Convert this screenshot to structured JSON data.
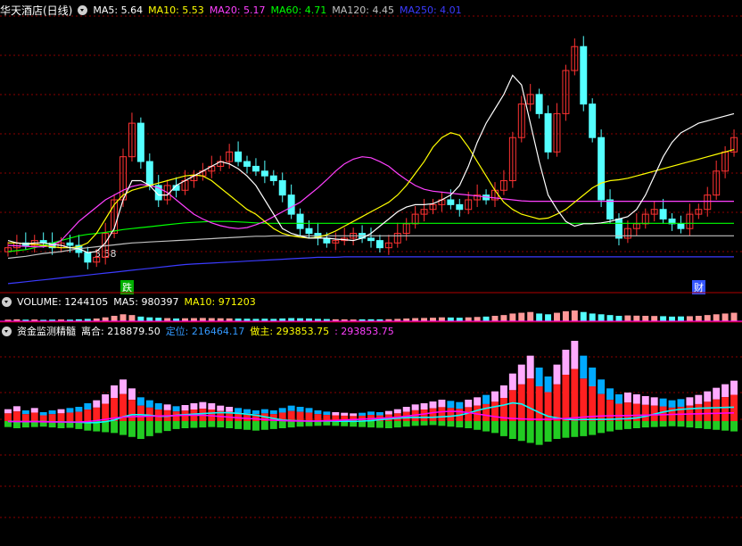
{
  "colors": {
    "bg": "#000000",
    "grid": "#8b0000",
    "separator": "#b00000",
    "up": "#ff3333",
    "down": "#54ffff",
    "ma5": "#ffffff",
    "ma10": "#ffff00",
    "ma20": "#ff40ff",
    "ma60": "#00ff00",
    "ma120": "#c0c0c0",
    "ma250": "#3b3bff",
    "fund_pink": "#ffaaff",
    "fund_red": "#ff2020",
    "fund_blue": "#00aaff",
    "fund_green": "#22cc22",
    "fund_cyan": "#00ffff",
    "fund_magenta": "#ff00ff"
  },
  "price_panel": {
    "title": "华天酒店(日线)",
    "ma_labels": [
      {
        "text": "MA5: 5.64",
        "color": "#ffffff"
      },
      {
        "text": "MA10: 5.53",
        "color": "#ffff00"
      },
      {
        "text": "MA20: 5.17",
        "color": "#ff40ff"
      },
      {
        "text": "MA60: 4.71",
        "color": "#00ff00"
      },
      {
        "text": "MA120: 4.45",
        "color": "#c0c0c0"
      },
      {
        "text": "MA250: 4.01",
        "color": "#3b3bff"
      }
    ],
    "low_marker": "3.58",
    "signal_fall": "跌",
    "signal_fin": "财"
  },
  "volume_panel": {
    "labels": [
      {
        "text": "VOLUME: 1244105",
        "color": "#ffffff"
      },
      {
        "text": "MA5: 980397",
        "color": "#ffffff"
      },
      {
        "text": "MA10: 971203",
        "color": "#ffff00"
      }
    ]
  },
  "fund_panel": {
    "labels": [
      {
        "text": "资金监测精髓",
        "color": "#ffffff"
      },
      {
        "text": "离合: 218879.50",
        "color": "#ffffff"
      },
      {
        "text": "定位: 216464.17",
        "color": "#3399ff"
      },
      {
        "text": "做主: 293853.75",
        "color": "#ffff00"
      },
      {
        "text": ": 293853.75",
        "color": "#ff40ff"
      }
    ]
  },
  "chart_data": [
    {
      "type": "candlestick",
      "title": "华天酒店(日线)",
      "low_label": 3.58,
      "ma_latest": {
        "MA5": 5.64,
        "MA10": 5.53,
        "MA20": 5.17,
        "MA60": 4.71,
        "MA120": 4.45,
        "MA250": 4.01
      },
      "ylim": [
        3.3,
        9.0
      ],
      "close": [
        4.2,
        4.3,
        4.25,
        4.35,
        4.3,
        4.2,
        4.3,
        4.25,
        4.1,
        3.9,
        4.0,
        4.5,
        5.2,
        6.1,
        6.8,
        6.0,
        5.5,
        5.2,
        5.5,
        5.4,
        5.6,
        5.7,
        5.8,
        5.9,
        6.0,
        6.2,
        6.0,
        5.9,
        5.8,
        5.7,
        5.6,
        5.3,
        4.9,
        4.6,
        4.5,
        4.4,
        4.3,
        4.35,
        4.4,
        4.5,
        4.4,
        4.35,
        4.2,
        4.3,
        4.5,
        4.7,
        4.9,
        5.0,
        5.1,
        5.2,
        5.1,
        5.0,
        5.2,
        5.3,
        5.2,
        5.4,
        5.6,
        6.5,
        7.2,
        7.4,
        7.0,
        6.2,
        7.0,
        7.9,
        8.4,
        7.2,
        6.5,
        5.2,
        4.8,
        4.4,
        4.6,
        4.7,
        4.9,
        5.0,
        4.8,
        4.7,
        4.6,
        4.9,
        5.0,
        5.3,
        5.8,
        6.2,
        6.5
      ],
      "ma5": [
        4.35,
        4.3,
        4.28,
        4.3,
        4.3,
        4.27,
        4.25,
        4.2,
        4.18,
        4.1,
        4.12,
        4.3,
        4.6,
        5.2,
        5.6,
        5.6,
        5.5,
        5.3,
        5.3,
        5.5,
        5.6,
        5.7,
        5.8,
        5.9,
        6.0,
        5.95,
        5.85,
        5.7,
        5.5,
        5.2,
        4.9,
        4.6,
        4.5,
        4.45,
        4.4,
        4.4,
        4.4,
        4.38,
        4.37,
        4.35,
        4.4,
        4.5,
        4.65,
        4.8,
        4.95,
        5.05,
        5.1,
        5.1,
        5.12,
        5.2,
        5.3,
        5.5,
        5.9,
        6.4,
        6.8,
        7.1,
        7.4,
        7.8,
        7.6,
        6.8,
        6.0,
        5.3,
        5.0,
        4.75,
        4.65,
        4.7,
        4.7,
        4.72,
        4.75,
        4.8,
        4.85,
        5.0,
        5.3,
        5.7,
        6.1,
        6.4,
        6.6,
        6.7,
        6.8,
        6.85,
        6.9,
        6.95,
        7.0
      ],
      "ma10": [
        4.3,
        4.3,
        4.28,
        4.27,
        4.25,
        4.22,
        4.2,
        4.2,
        4.22,
        4.3,
        4.5,
        4.8,
        5.1,
        5.3,
        5.4,
        5.45,
        5.5,
        5.55,
        5.6,
        5.65,
        5.7,
        5.72,
        5.7,
        5.6,
        5.45,
        5.3,
        5.15,
        5.0,
        4.9,
        4.75,
        4.6,
        4.5,
        4.45,
        4.42,
        4.4,
        4.42,
        4.47,
        4.55,
        4.65,
        4.75,
        4.85,
        4.95,
        5.05,
        5.15,
        5.3,
        5.5,
        5.75,
        6.0,
        6.3,
        6.5,
        6.6,
        6.55,
        6.3,
        6.0,
        5.7,
        5.4,
        5.15,
        5.0,
        4.9,
        4.85,
        4.8,
        4.82,
        4.9,
        5.0,
        5.15,
        5.3,
        5.45,
        5.55,
        5.6,
        5.62,
        5.65,
        5.7,
        5.75,
        5.8,
        5.85,
        5.9,
        5.95,
        6.0,
        6.05,
        6.1,
        6.15,
        6.2,
        6.25
      ],
      "ma20": [
        4.25,
        4.24,
        4.23,
        4.22,
        4.22,
        4.25,
        4.35,
        4.55,
        4.75,
        4.9,
        5.05,
        5.2,
        5.3,
        5.4,
        5.48,
        5.52,
        5.5,
        5.45,
        5.35,
        5.2,
        5.05,
        4.9,
        4.8,
        4.72,
        4.66,
        4.62,
        4.6,
        4.62,
        4.68,
        4.75,
        4.85,
        4.95,
        5.05,
        5.15,
        5.3,
        5.45,
        5.62,
        5.8,
        5.95,
        6.05,
        6.1,
        6.08,
        6.0,
        5.9,
        5.75,
        5.62,
        5.5,
        5.42,
        5.38,
        5.36,
        5.34,
        5.32,
        5.3,
        5.28,
        5.26,
        5.24,
        5.22,
        5.2,
        5.18,
        5.17,
        5.17,
        5.17,
        5.17,
        5.17,
        5.17,
        5.17,
        5.17,
        5.17,
        5.17,
        5.17,
        5.17,
        5.17,
        5.17,
        5.17,
        5.17,
        5.17,
        5.17,
        5.17,
        5.17,
        5.17,
        5.17,
        5.17,
        5.17
      ],
      "ma60": [
        4.12,
        4.14,
        4.16,
        4.2,
        4.25,
        4.3,
        4.35,
        4.4,
        4.45,
        4.48,
        4.5,
        4.52,
        4.55,
        4.58,
        4.6,
        4.62,
        4.64,
        4.66,
        4.68,
        4.7,
        4.72,
        4.73,
        4.74,
        4.75,
        4.75,
        4.75,
        4.74,
        4.73,
        4.72,
        4.71,
        4.71,
        4.71,
        4.71,
        4.71,
        4.71,
        4.71,
        4.71,
        4.71,
        4.71,
        4.71,
        4.71,
        4.71,
        4.71,
        4.71,
        4.71,
        4.71,
        4.71,
        4.71,
        4.71,
        4.71,
        4.71,
        4.71,
        4.71,
        4.71,
        4.71,
        4.71,
        4.71,
        4.71,
        4.71,
        4.71,
        4.71,
        4.71,
        4.71,
        4.71,
        4.71,
        4.71,
        4.71,
        4.71,
        4.71,
        4.71,
        4.71,
        4.71,
        4.71,
        4.71,
        4.71,
        4.71,
        4.71,
        4.71,
        4.71,
        4.71,
        4.71,
        4.71,
        4.71
      ],
      "ma120": [
        3.98,
        4.0,
        4.02,
        4.05,
        4.08,
        4.1,
        4.12,
        4.15,
        4.18,
        4.2,
        4.22,
        4.24,
        4.26,
        4.28,
        4.3,
        4.31,
        4.32,
        4.33,
        4.34,
        4.35,
        4.36,
        4.37,
        4.38,
        4.39,
        4.4,
        4.41,
        4.42,
        4.43,
        4.44,
        4.44,
        4.45,
        4.45,
        4.45,
        4.45,
        4.45,
        4.45,
        4.45,
        4.45,
        4.45,
        4.45,
        4.45,
        4.45,
        4.45,
        4.45,
        4.45,
        4.45,
        4.45,
        4.45,
        4.45,
        4.45,
        4.45,
        4.45,
        4.45,
        4.45,
        4.45,
        4.45,
        4.45,
        4.45,
        4.45,
        4.45,
        4.45,
        4.45,
        4.45,
        4.45,
        4.45,
        4.45,
        4.45,
        4.45,
        4.45,
        4.45,
        4.45,
        4.45,
        4.45,
        4.45,
        4.45,
        4.45,
        4.45,
        4.45,
        4.45,
        4.45,
        4.45,
        4.45,
        4.45
      ],
      "ma250": [
        3.45,
        3.47,
        3.49,
        3.51,
        3.53,
        3.55,
        3.57,
        3.59,
        3.61,
        3.63,
        3.65,
        3.67,
        3.69,
        3.71,
        3.73,
        3.75,
        3.77,
        3.79,
        3.81,
        3.83,
        3.85,
        3.86,
        3.87,
        3.88,
        3.89,
        3.9,
        3.91,
        3.92,
        3.93,
        3.94,
        3.95,
        3.96,
        3.97,
        3.98,
        3.99,
        4.0,
        4.0,
        4.0,
        4.01,
        4.01,
        4.01,
        4.01,
        4.01,
        4.01,
        4.01,
        4.01,
        4.01,
        4.01,
        4.01,
        4.01,
        4.01,
        4.01,
        4.01,
        4.01,
        4.01,
        4.01,
        4.01,
        4.01,
        4.01,
        4.01,
        4.01,
        4.01,
        4.01,
        4.01,
        4.01,
        4.01,
        4.01,
        4.01,
        4.01,
        4.01,
        4.01,
        4.01,
        4.01,
        4.01,
        4.01,
        4.01,
        4.01,
        4.01,
        4.01,
        4.01,
        4.01,
        4.01,
        4.01
      ]
    },
    {
      "type": "bar",
      "title": "VOLUME",
      "latest": {
        "VOLUME": 1244105,
        "MA5": 980397,
        "MA10": 971203
      },
      "values": [
        0.2,
        0.25,
        0.2,
        0.22,
        0.18,
        0.2,
        0.22,
        0.2,
        0.25,
        0.3,
        0.35,
        0.5,
        0.7,
        0.9,
        0.8,
        0.6,
        0.5,
        0.45,
        0.4,
        0.35,
        0.38,
        0.4,
        0.42,
        0.4,
        0.38,
        0.36,
        0.34,
        0.32,
        0.3,
        0.32,
        0.3,
        0.35,
        0.4,
        0.38,
        0.35,
        0.3,
        0.28,
        0.25,
        0.24,
        0.22,
        0.24,
        0.25,
        0.24,
        0.26,
        0.3,
        0.35,
        0.4,
        0.42,
        0.45,
        0.5,
        0.48,
        0.45,
        0.5,
        0.55,
        0.6,
        0.7,
        0.8,
        1.0,
        1.1,
        1.2,
        1.0,
        0.9,
        1.1,
        1.3,
        1.4,
        1.2,
        1.0,
        0.9,
        0.8,
        0.7,
        0.75,
        0.72,
        0.7,
        0.68,
        0.65,
        0.6,
        0.62,
        0.65,
        0.7,
        0.8,
        0.9,
        1.0,
        1.1
      ]
    },
    {
      "type": "bar",
      "title": "资金监测精髓",
      "latest": {
        "离合": 218879.5,
        "定位": 216464.17,
        "做主": 293853.75
      },
      "positive": [
        20,
        25,
        18,
        22,
        15,
        18,
        20,
        22,
        24,
        30,
        35,
        45,
        60,
        70,
        55,
        40,
        35,
        30,
        28,
        25,
        27,
        30,
        32,
        30,
        26,
        24,
        22,
        20,
        18,
        20,
        18,
        22,
        26,
        24,
        22,
        18,
        16,
        15,
        14,
        13,
        14,
        16,
        15,
        17,
        20,
        24,
        28,
        30,
        33,
        36,
        34,
        32,
        36,
        40,
        44,
        50,
        60,
        80,
        95,
        110,
        90,
        75,
        95,
        120,
        135,
        110,
        90,
        70,
        55,
        45,
        48,
        45,
        42,
        40,
        38,
        35,
        37,
        40,
        44,
        50,
        56,
        62,
        68
      ],
      "negative": [
        15,
        18,
        16,
        15,
        14,
        16,
        18,
        17,
        20,
        24,
        26,
        28,
        30,
        35,
        40,
        45,
        38,
        30,
        25,
        20,
        18,
        17,
        16,
        15,
        16,
        18,
        20,
        22,
        24,
        22,
        20,
        18,
        16,
        14,
        13,
        12,
        11,
        12,
        13,
        14,
        15,
        16,
        17,
        18,
        16,
        14,
        12,
        11,
        10,
        12,
        14,
        16,
        18,
        22,
        26,
        30,
        38,
        45,
        50,
        55,
        60,
        52,
        45,
        42,
        40,
        38,
        35,
        30,
        26,
        22,
        20,
        18,
        16,
        15,
        14,
        13,
        14,
        16,
        18,
        20,
        22,
        24,
        26
      ]
    }
  ]
}
